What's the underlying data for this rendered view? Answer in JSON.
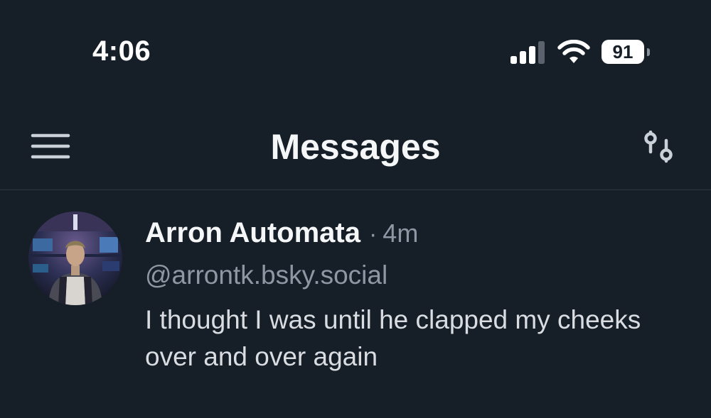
{
  "status_bar": {
    "time": "4:06",
    "battery_level": "91",
    "signal_bars_active": 3,
    "signal_bars_total": 4
  },
  "header": {
    "title": "Messages",
    "menu_icon": "hamburger-menu-icon",
    "settings_icon": "sliders-icon"
  },
  "conversations": [
    {
      "name": "Arron Automata",
      "separator": "·",
      "time_ago": "4m",
      "handle": "@arrontk.bsky.social",
      "preview": "I thought I was until he clapped my cheeks over and over again"
    }
  ],
  "colors": {
    "background": "#161e27",
    "primary_text": "#f4f6f8",
    "secondary_text": "#8e98a5",
    "divider": "#2c3540"
  }
}
